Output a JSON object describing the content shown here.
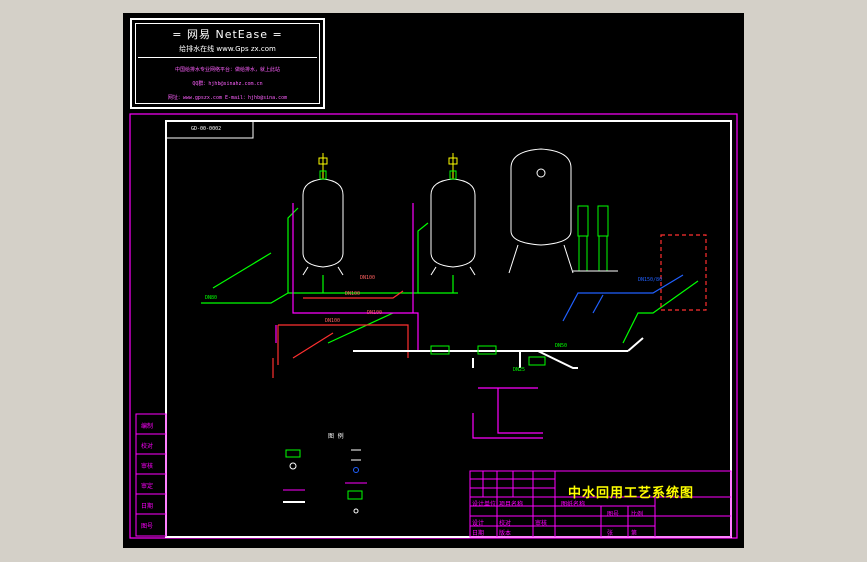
{
  "logo": {
    "title": "= 网易 NetEase =",
    "subtitle": "给排水在线    www.Gps zx.com",
    "line1": "中国给排水专业网络平台：做给排水，就上此站",
    "line2": "QQ群：hjhb@sinahz.com.cn",
    "line3": "网址：www.gpszx.com   E-mail：hjhb@sina.com"
  },
  "drawing": {
    "code": "GD-00-0002",
    "title": "中水回用工艺系统图",
    "legend_title": "图 例",
    "left_stamps": [
      "编制",
      "校对",
      "审核",
      "审定",
      "日期",
      "图号"
    ],
    "title_block": {
      "row1": [
        "设计单位",
        "项目名称",
        "图纸名称",
        "图号"
      ],
      "row2": [
        "设计",
        "校对",
        "审核",
        "比例"
      ],
      "row3": [
        "日期",
        "版本",
        "张",
        "第"
      ]
    },
    "labels": {
      "dn100_a": "DN100",
      "dn100_b": "DN100",
      "dn100_c": "DN100",
      "dn100_d": "DN100",
      "dn80": "DN80",
      "dn50": "DN50",
      "dn150": "DN150/80",
      "dn25": "DN25"
    }
  },
  "colors": {
    "background": "#000000",
    "frame": "#ff00ff",
    "border": "#ffffff",
    "pipe_green": "#00ff00",
    "pipe_red": "#ff3030",
    "pipe_blue": "#2060ff",
    "text_yellow": "#ffff00",
    "window_bg": "#d4d0c8"
  }
}
